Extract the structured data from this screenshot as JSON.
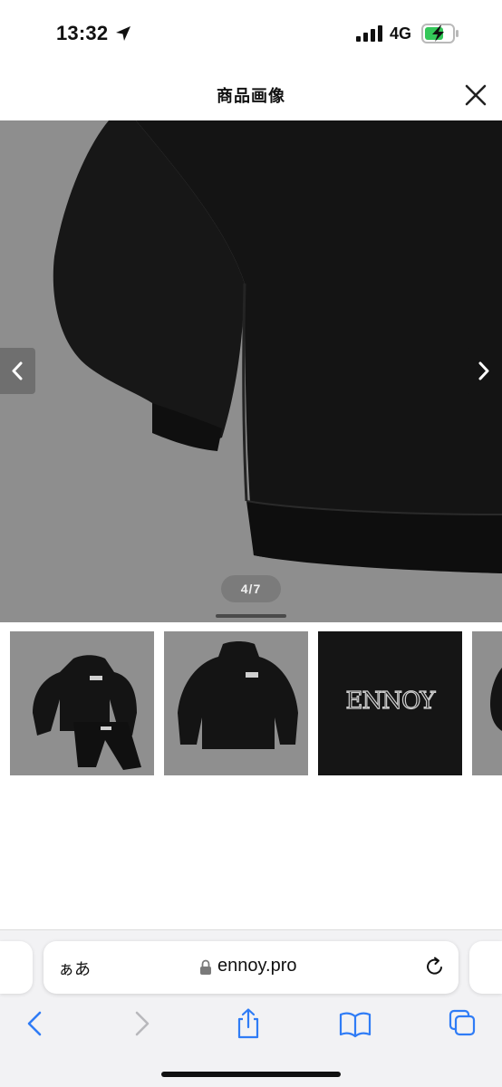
{
  "status_bar": {
    "time": "13:32",
    "network": "4G"
  },
  "header": {
    "title": "商品画像"
  },
  "gallery": {
    "counter": "4/7",
    "thumbnails": [
      {
        "brand_text": ""
      },
      {
        "brand_text": ""
      },
      {
        "brand_text": "ENNOY"
      },
      {
        "brand_text": ""
      }
    ]
  },
  "browser": {
    "reader_label": "ぁあ",
    "url": "ennoy.pro"
  },
  "colors": {
    "image_background": "#8e8e8e",
    "garment": "#141414",
    "accent_blue": "#2f7cf6"
  },
  "icons": {
    "location": "location-arrow-icon",
    "signal": "cellular-signal-icon",
    "battery": "battery-charging-icon",
    "close": "close-icon",
    "prev": "chevron-left-icon",
    "next": "chevron-right-icon",
    "lock": "lock-icon",
    "reload": "reload-icon",
    "back": "back-icon",
    "forward": "forward-icon",
    "share": "share-icon",
    "bookmarks": "bookmarks-icon",
    "tabs": "tabs-icon"
  }
}
